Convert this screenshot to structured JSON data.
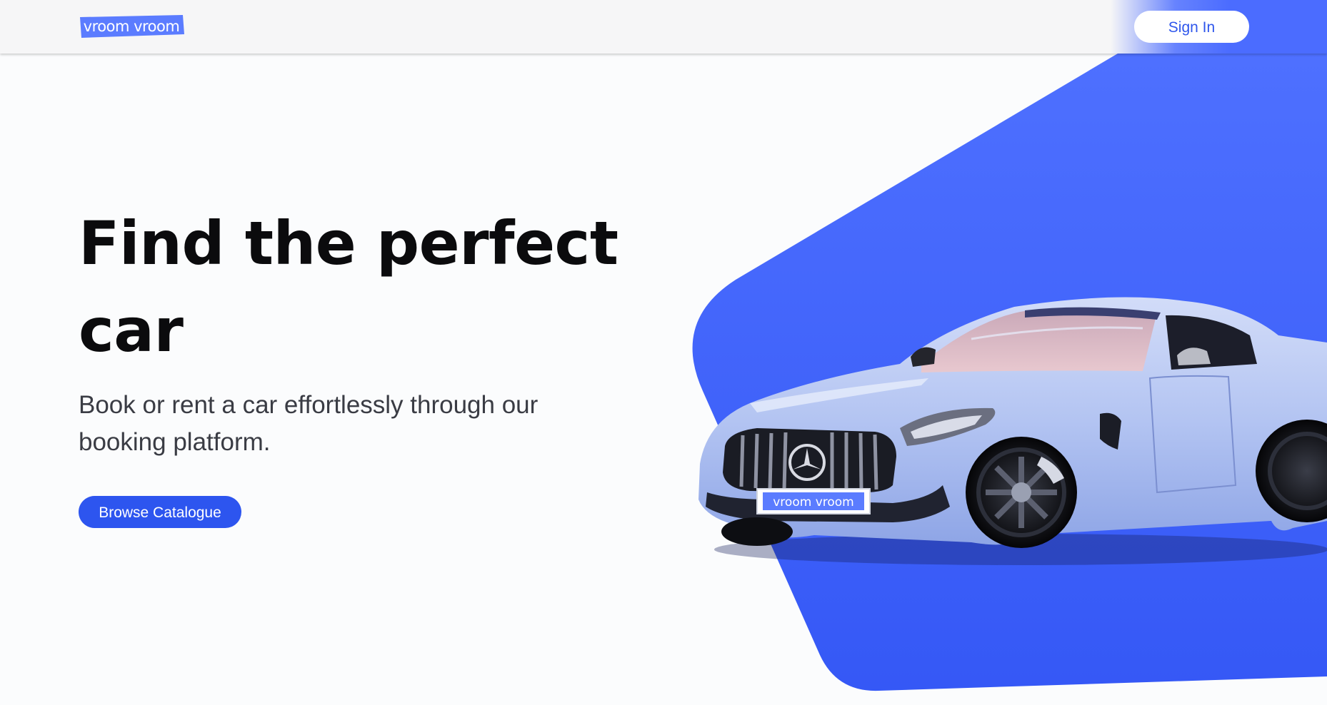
{
  "header": {
    "logo_text": "vroom vroom",
    "sign_in_label": "Sign In"
  },
  "hero": {
    "title": "Find the perfect car",
    "subtitle": "Book or rent a car effortlessly through our booking platform.",
    "cta_label": "Browse Catalogue",
    "car_plate_text": "vroom vroom"
  },
  "colors": {
    "brand_blue": "#2d55ef",
    "panel_blue": "#4b6cff",
    "logo_blue": "#5b7cff",
    "car_body": "#b8c8f4",
    "background": "#fbfcfd"
  },
  "icons": {
    "logo": "vroom-vroom-logo",
    "car": "sports-car-image"
  }
}
